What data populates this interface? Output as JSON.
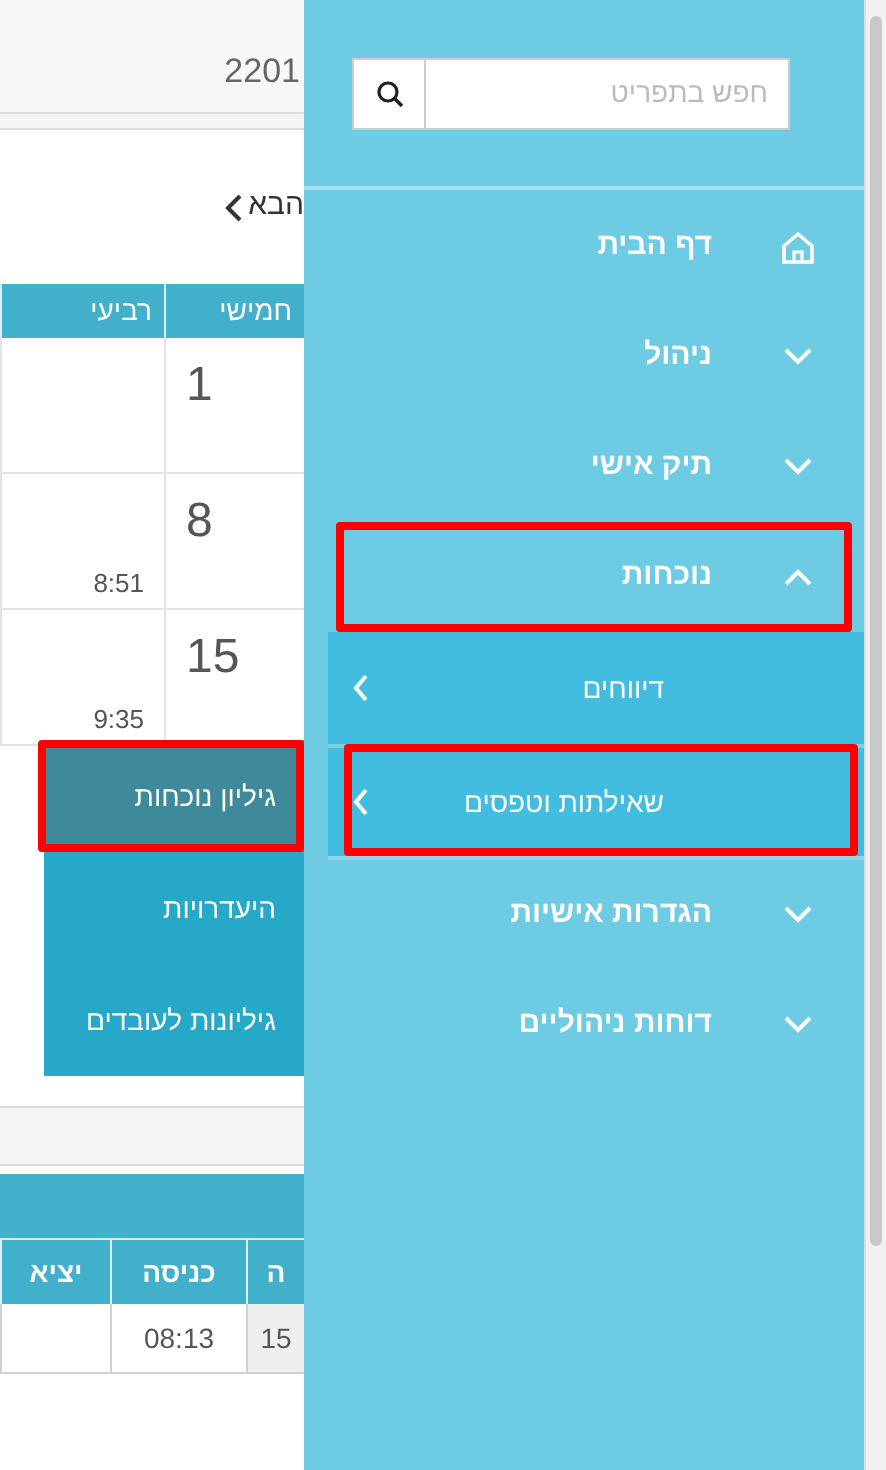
{
  "content": {
    "header_text": "2201",
    "next_link": "הבא",
    "calendar": {
      "columns": [
        "חמישי",
        "רביעי"
      ],
      "rows": [
        [
          {
            "day": "1"
          },
          {}
        ],
        [
          {
            "day": "8"
          },
          {
            "time": "8:51"
          }
        ],
        [
          {
            "day": "15"
          },
          {
            "time": "9:35"
          }
        ]
      ]
    },
    "table": {
      "columns": [
        "ה",
        "כניסה",
        "יציא"
      ],
      "rows": [
        [
          "15",
          "08:13",
          ""
        ]
      ]
    }
  },
  "popup_menu": [
    {
      "label": "גיליון נוכחות",
      "selected": true,
      "highlighted": true
    },
    {
      "label": "היעדרויות",
      "selected": false,
      "highlighted": false
    },
    {
      "label": "גיליונות לעובדים",
      "selected": false,
      "highlighted": false
    }
  ],
  "sidebar": {
    "search": {
      "placeholder": "חפש בתפריט"
    },
    "items": [
      {
        "label": "דף הבית",
        "kind": "home"
      },
      {
        "label": "ניהול",
        "kind": "group",
        "expanded": false,
        "highlighted": false
      },
      {
        "label": "תיק אישי",
        "kind": "group",
        "expanded": false,
        "highlighted": false
      },
      {
        "label": "נוכחות",
        "kind": "group",
        "expanded": true,
        "highlighted": true,
        "children": [
          {
            "label": "דיווחים",
            "highlighted": false
          },
          {
            "label": "שאילתות וטפסים",
            "highlighted": true
          }
        ]
      },
      {
        "label": "הגדרות אישיות",
        "kind": "group",
        "expanded": false,
        "highlighted": false
      },
      {
        "label": "דוחות ניהוליים",
        "kind": "group",
        "expanded": false,
        "highlighted": false
      }
    ]
  }
}
